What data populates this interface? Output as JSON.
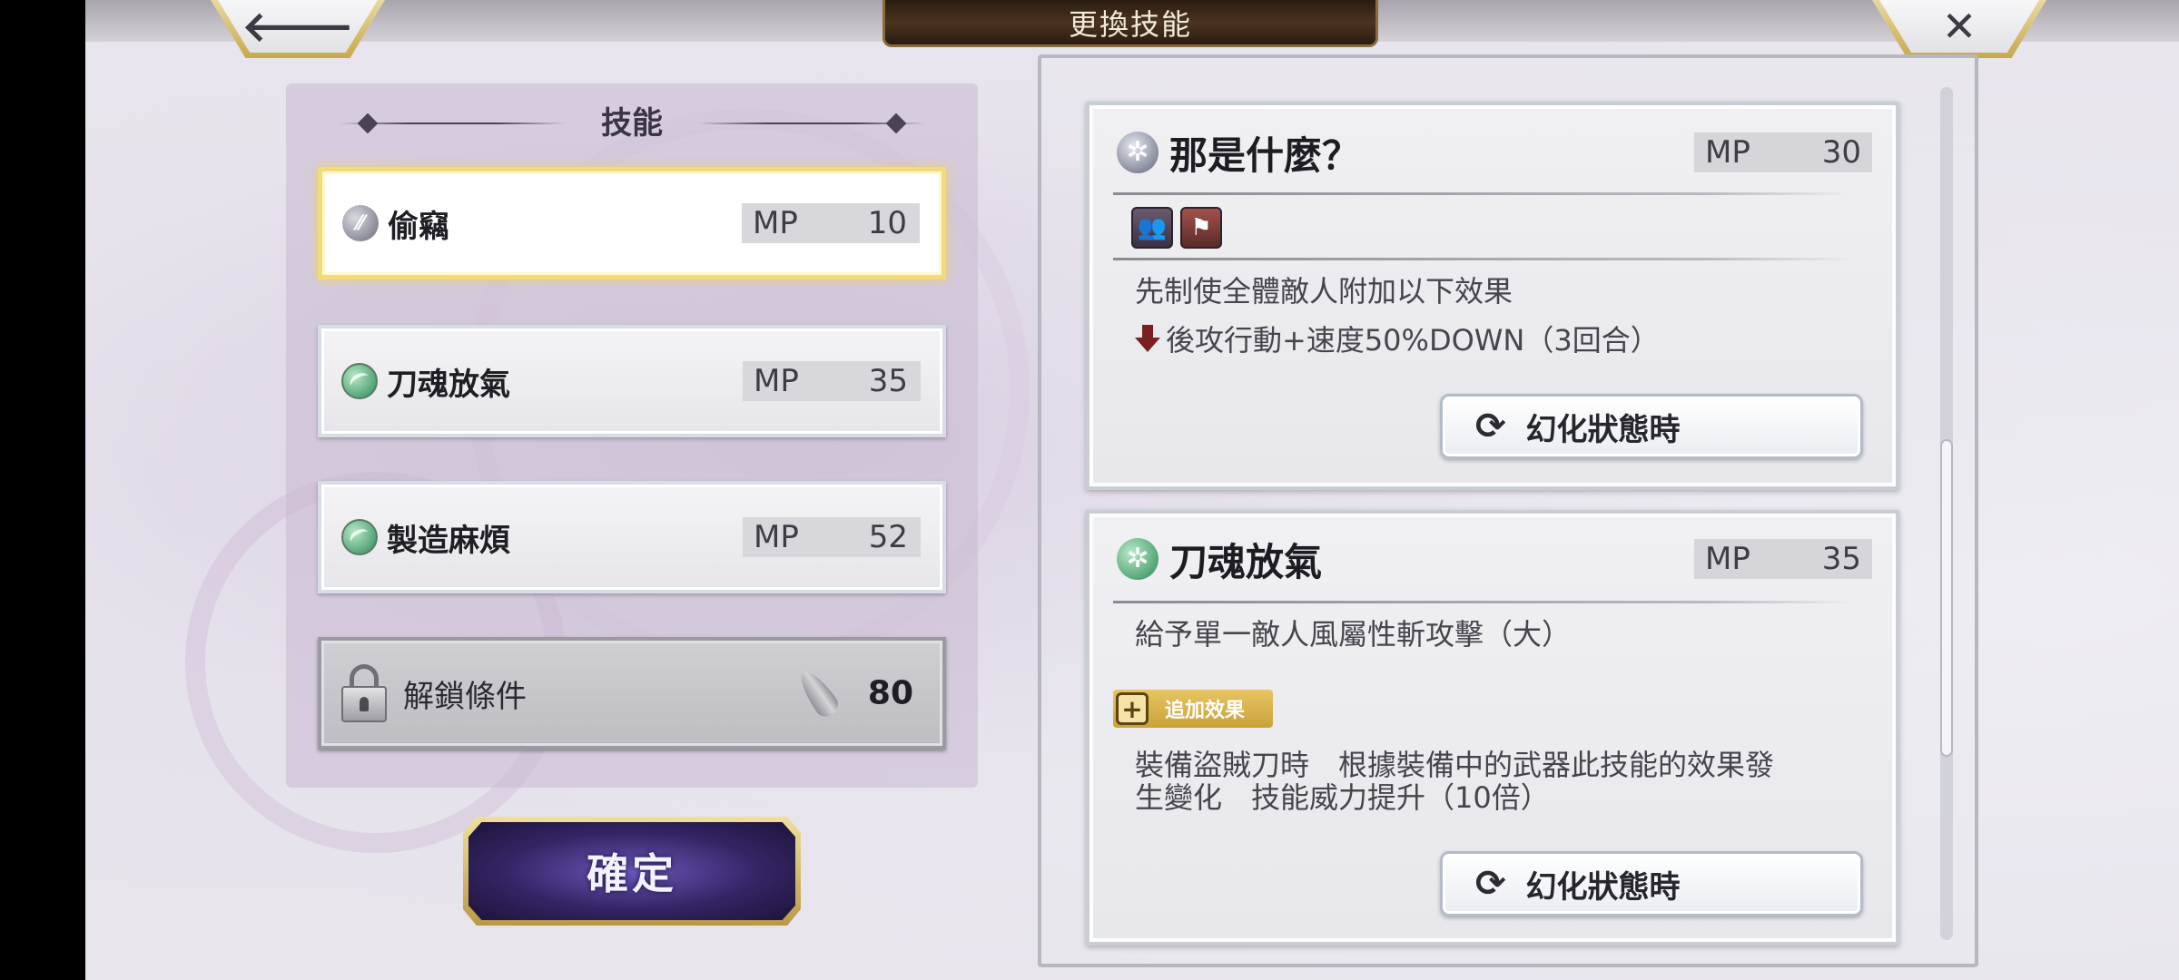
{
  "header": {
    "title": "更換技能",
    "back_glyph": "🡐",
    "close_glyph": "✕"
  },
  "skills_panel": {
    "title": "技能",
    "slots": [
      {
        "name": "偷竊",
        "mp_label": "MP",
        "mp_value": "10",
        "icon": "steal-icon",
        "selected": true
      },
      {
        "name": "刀魂放氣",
        "mp_label": "MP",
        "mp_value": "35",
        "icon": "wind-orb-icon",
        "selected": false
      },
      {
        "name": "製造麻煩",
        "mp_label": "MP",
        "mp_value": "52",
        "icon": "wind-orb-icon",
        "selected": false
      }
    ],
    "locked_slot": {
      "label": "解鎖條件",
      "cost": "80",
      "icon": "feather-icon"
    },
    "confirm_label": "確定"
  },
  "details": {
    "cards": [
      {
        "name": "那是什麼？",
        "mp_label": "MP",
        "mp_value": "30",
        "icon": "ninja-star-icon",
        "desc_line1": "先制使全體敵人附加以下效果",
        "desc_line2": "後攻行動+速度50%DOWN（3回合）",
        "phantom_label": "幻化狀態時"
      },
      {
        "name": "刀魂放氣",
        "mp_label": "MP",
        "mp_value": "35",
        "icon": "wind-orb-icon",
        "desc_line1": "給予單一敵人風屬性斬攻擊（大）",
        "extra_effect_label": "追加效果",
        "extra_line1": "裝備盜賊刀時　根據裝備中的武器此技能的效果發",
        "extra_line2": "生變化　技能威力提升（10倍）",
        "phantom_label": "幻化狀態時"
      }
    ]
  },
  "colors": {
    "selected_border": "#f1dc7a",
    "confirm_button": "#352465",
    "debuff_arrow": "#7a2020",
    "extra_effect_badge": "#d8b34e"
  }
}
